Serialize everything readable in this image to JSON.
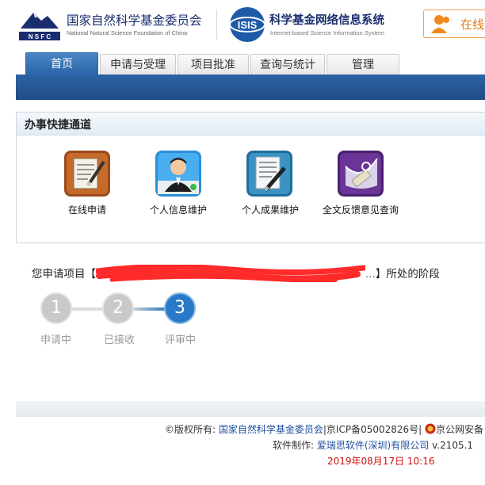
{
  "header": {
    "nsfc_short": "N S F C",
    "nsfc_title_cn": "国家自然科学基金委员会",
    "nsfc_title_en": "National Natural Science Foundation of China",
    "isis_short": "ISIS",
    "isis_title_cn": "科学基金网络信息系统",
    "isis_title_en": "Internet-based Science Information System",
    "online_label": "在线"
  },
  "nav": {
    "tabs": [
      {
        "label": "首页",
        "active": true
      },
      {
        "label": "申请与受理",
        "active": false
      },
      {
        "label": "项目批准",
        "active": false
      },
      {
        "label": "查询与统计",
        "active": false
      },
      {
        "label": "管理",
        "active": false
      }
    ]
  },
  "quick": {
    "title": "办事快捷通道",
    "items": [
      {
        "label": "在线申请",
        "icon": "online-application-icon"
      },
      {
        "label": "个人信息维护",
        "icon": "personal-info-icon"
      },
      {
        "label": "个人成果维护",
        "icon": "personal-achievements-icon"
      },
      {
        "label": "全文反馈意见查询",
        "icon": "fulltext-feedback-icon"
      }
    ]
  },
  "status": {
    "prefix": "您申请项目【",
    "redacted_tail": "...",
    "suffix": "】所处的阶段"
  },
  "steps": [
    {
      "number": "1",
      "label": "申请中",
      "state": "done"
    },
    {
      "number": "2",
      "label": "已接收",
      "state": "done"
    },
    {
      "number": "3",
      "label": "评审中",
      "state": "current"
    }
  ],
  "footer": {
    "copyright_prefix": "©版权所有:",
    "copyright_owner": "国家自然科学基金委员会",
    "icp": "|京ICP备05002826号|",
    "police": "京公网安备",
    "software_prefix": "软件制作:",
    "software_company": "爱瑞思软件(深圳)有限公司",
    "version": "v.2105.1",
    "datetime": "2019年08月17日 10:16"
  },
  "colors": {
    "nav_blue": "#2a64a8",
    "step_current": "#2a79c8",
    "step_done": "#c9c9c9",
    "link": "#1f4fa0",
    "date_red": "#cc1111",
    "online_orange": "#e07a10"
  }
}
